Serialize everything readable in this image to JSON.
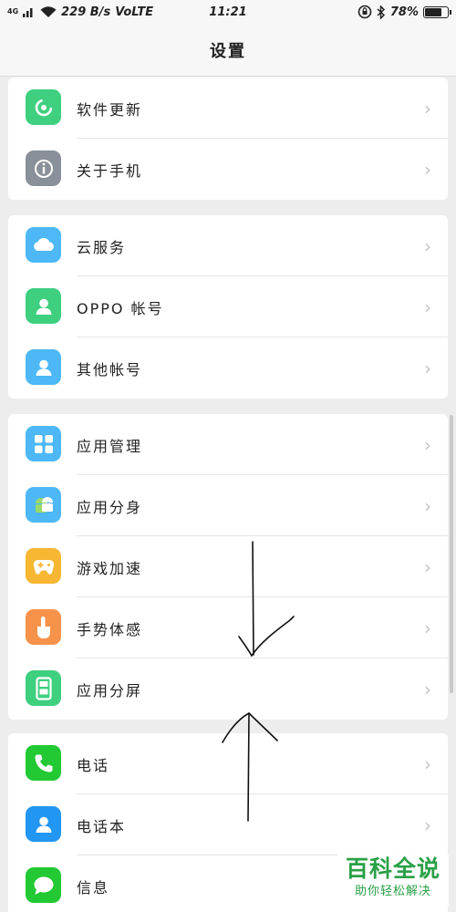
{
  "status_bar": {
    "network_type": "4G",
    "speed": "229 B/s",
    "volte": "VoLTE",
    "time": "11:21",
    "battery_percent": "78%",
    "battery_level": 0.78
  },
  "header": {
    "title": "设置"
  },
  "groups": [
    {
      "items": [
        {
          "label": "软件更新",
          "icon": "refresh-icon",
          "color": "#3ecf7f"
        },
        {
          "label": "关于手机",
          "icon": "info-icon",
          "color": "#8a9099"
        }
      ]
    },
    {
      "items": [
        {
          "label": "云服务",
          "icon": "cloud-icon",
          "color": "#4db8f5"
        },
        {
          "label": "OPPO 帐号",
          "icon": "user-icon",
          "color": "#3ecf7f"
        },
        {
          "label": "其他帐号",
          "icon": "user-icon",
          "color": "#4db8f5"
        }
      ]
    },
    {
      "items": [
        {
          "label": "应用管理",
          "icon": "grid-icon",
          "color": "#4db8f5"
        },
        {
          "label": "应用分身",
          "icon": "android-icon",
          "color": "#4db8f5"
        },
        {
          "label": "游戏加速",
          "icon": "gamepad-icon",
          "color": "#f7b733"
        },
        {
          "label": "手势体感",
          "icon": "hand-icon",
          "color": "#f7924a"
        },
        {
          "label": "应用分屏",
          "icon": "split-screen-icon",
          "color": "#3ecf7f"
        }
      ]
    },
    {
      "items": [
        {
          "label": "电话",
          "icon": "phone-icon",
          "color": "#22c933"
        },
        {
          "label": "电话本",
          "icon": "contact-icon",
          "color": "#2196f3"
        },
        {
          "label": "信息",
          "icon": "message-icon",
          "color": "#22c933"
        }
      ]
    }
  ],
  "watermark": {
    "main": "百科全说",
    "sub": "助你轻松解决"
  }
}
